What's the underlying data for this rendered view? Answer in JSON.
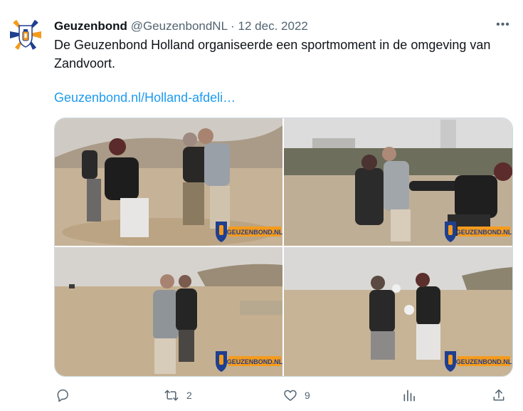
{
  "tweet": {
    "author_name": "Geuzenbond",
    "author_handle": "@GeuzenbondNL",
    "separator": "·",
    "date": "12 dec. 2022",
    "text": "De Geuzenbond Holland organiseerde een sportmoment in de omgeving van Zandvoort.",
    "link_text": "Geuzenbond.nl/Holland-afdeli…",
    "more_label": "•••"
  },
  "media": {
    "watermark": "GEUZENBOND.NL",
    "photos": [
      {
        "icon": "beach-photo-1"
      },
      {
        "icon": "beach-photo-2"
      },
      {
        "icon": "beach-photo-3"
      },
      {
        "icon": "beach-photo-4"
      }
    ]
  },
  "actions": {
    "reply_count": "",
    "retweet_count": "2",
    "like_count": "9",
    "views_count": "",
    "icons": [
      "reply-icon",
      "retweet-icon",
      "like-icon",
      "views-icon",
      "share-icon"
    ]
  },
  "colors": {
    "link": "#1d9bf0",
    "secondary_text": "#536471",
    "logo_orange": "#f59b1c",
    "logo_blue": "#1f3f8f"
  }
}
